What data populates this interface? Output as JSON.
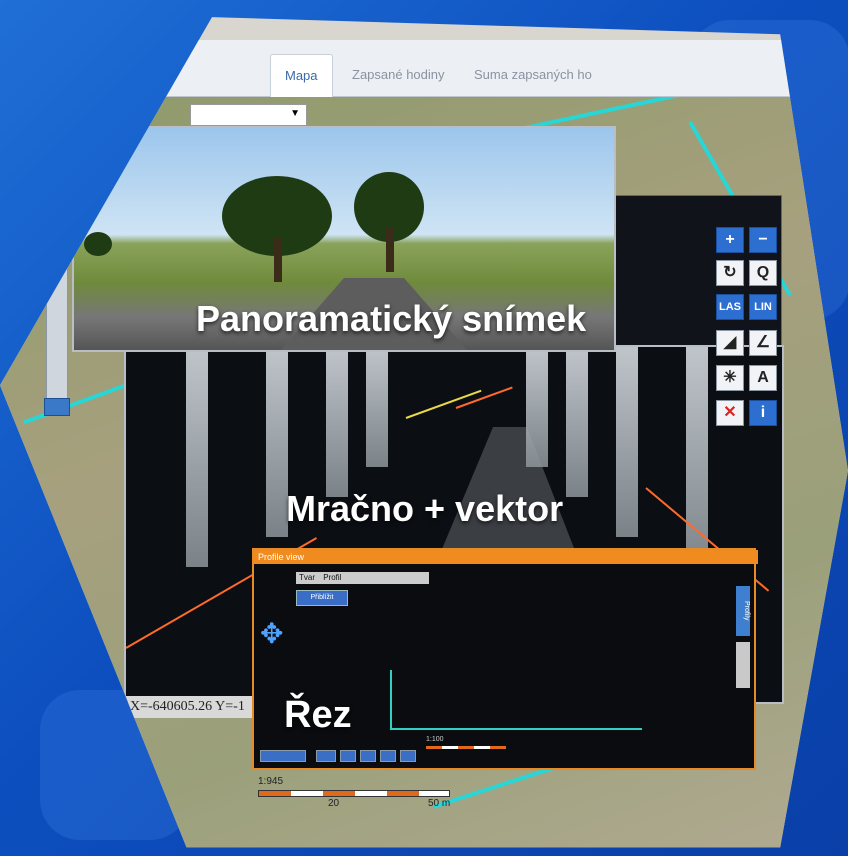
{
  "tabs": [
    {
      "label": "Mapa",
      "active": true
    },
    {
      "label": "Zapsané hodiny",
      "active": false
    },
    {
      "label": "Suma zapsaných ho",
      "active": false
    }
  ],
  "captions": {
    "panorama": "Panoramatický snímek",
    "cloud": "Mračno + vektor",
    "section": "Řez"
  },
  "coordinates": "X=-640605.26 Y=-1",
  "toolbar": {
    "tools": [
      {
        "icon": "zoom-in-icon",
        "glyph": "+"
      },
      {
        "icon": "zoom-out-icon",
        "glyph": "−"
      },
      {
        "icon": "refresh-icon",
        "glyph": "↻"
      },
      {
        "icon": "zoom-box-icon",
        "glyph": "Q"
      },
      {
        "icon": "las-icon",
        "glyph": "LAS"
      },
      {
        "icon": "lin-icon",
        "glyph": "LIN"
      },
      {
        "icon": "triangle-icon",
        "glyph": "◢"
      },
      {
        "icon": "angle-icon",
        "glyph": "∠"
      },
      {
        "icon": "snap-icon",
        "glyph": "✳"
      },
      {
        "icon": "text-icon",
        "glyph": "A"
      },
      {
        "icon": "delete-icon",
        "glyph": "✕"
      },
      {
        "icon": "info-icon",
        "glyph": "i"
      }
    ]
  },
  "profile": {
    "title": "Profile view",
    "type_label": "Tvar",
    "type_value": "Profil",
    "action_button": "Přiblížit",
    "side_tab": "Profily",
    "scale_text": "1:100"
  },
  "map_scale": {
    "ratio": "1:945",
    "label_20": "20",
    "label_50": "50 m"
  },
  "colors": {
    "background": "#0d4fbf",
    "accent_orange": "#f08b1f",
    "road_cyan": "#28d6d6"
  }
}
